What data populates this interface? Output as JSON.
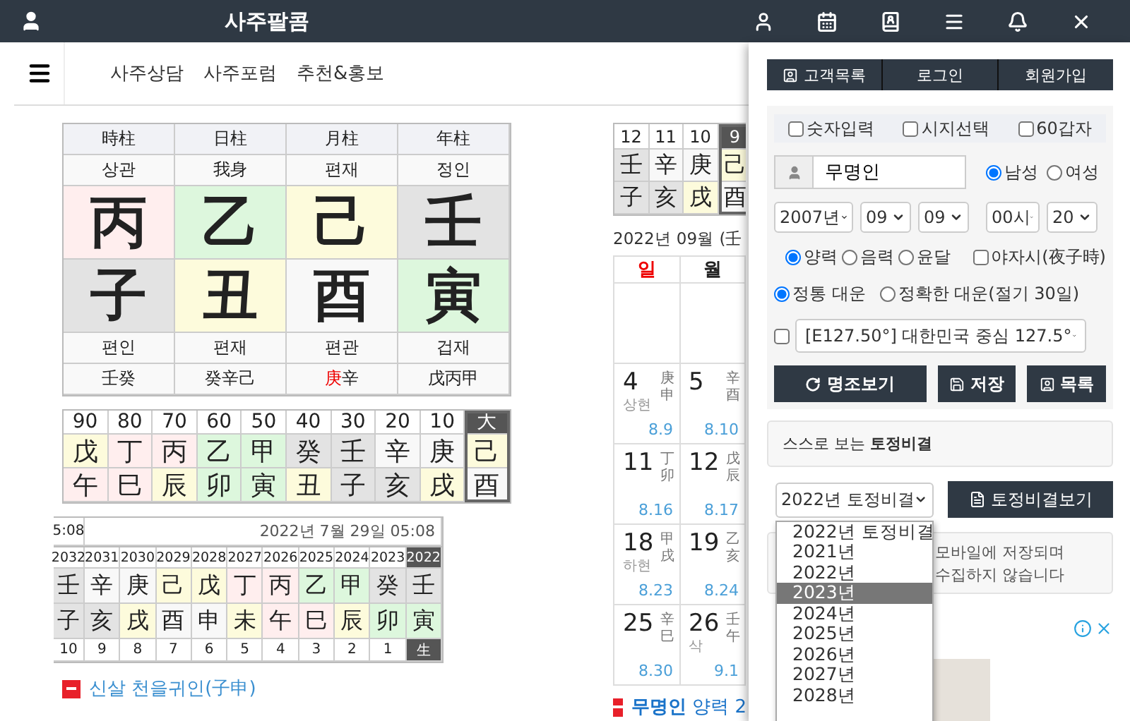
{
  "header": {
    "title": "사주팔콤"
  },
  "nav": {
    "links": [
      "사주상담",
      "사주포럼",
      "추천&홍보"
    ]
  },
  "pillars": {
    "columns": [
      "時柱",
      "日柱",
      "月柱",
      "年柱"
    ],
    "top_labels": [
      "상관",
      "我身",
      "편재",
      "정인"
    ],
    "stems": [
      {
        "char": "丙",
        "color": "#ffeeee"
      },
      {
        "char": "乙",
        "color": "#ddf7dd"
      },
      {
        "char": "己",
        "color": "#fdfbdc"
      },
      {
        "char": "壬",
        "color": "#e3e3e3"
      }
    ],
    "branches": [
      {
        "char": "子",
        "color": "#e3e3e3"
      },
      {
        "char": "丑",
        "color": "#fdfbdc"
      },
      {
        "char": "酉",
        "color": "#f8f8f8"
      },
      {
        "char": "寅",
        "color": "#ddf7dd"
      }
    ],
    "bottom_labels": [
      "편인",
      "편재",
      "편관",
      "겁재"
    ],
    "hidden_stems": [
      [
        {
          "text": "壬癸",
          "red": false
        }
      ],
      [
        {
          "text": "癸辛己",
          "red": false
        }
      ],
      [
        {
          "text": "庚",
          "red": true
        },
        {
          "text": "辛",
          "red": false
        }
      ],
      [
        {
          "text": "戊丙甲",
          "red": false
        }
      ]
    ]
  },
  "daewoon": {
    "columns": [
      {
        "age": "90",
        "stem": {
          "char": "戊",
          "color": "#fdfbdc"
        },
        "branch": {
          "char": "午",
          "color": "#ffeeee"
        },
        "selected": false
      },
      {
        "age": "80",
        "stem": {
          "char": "丁",
          "color": "#ffeeee"
        },
        "branch": {
          "char": "巳",
          "color": "#ffeeee"
        },
        "selected": false
      },
      {
        "age": "70",
        "stem": {
          "char": "丙",
          "color": "#ffeeee"
        },
        "branch": {
          "char": "辰",
          "color": "#fdfbdc"
        },
        "selected": false
      },
      {
        "age": "60",
        "stem": {
          "char": "乙",
          "color": "#ddf7dd"
        },
        "branch": {
          "char": "卯",
          "color": "#ddf7dd"
        },
        "selected": false
      },
      {
        "age": "50",
        "stem": {
          "char": "甲",
          "color": "#ddf7dd"
        },
        "branch": {
          "char": "寅",
          "color": "#ddf7dd"
        },
        "selected": false
      },
      {
        "age": "40",
        "stem": {
          "char": "癸",
          "color": "#e3e3e3"
        },
        "branch": {
          "char": "丑",
          "color": "#fdfbdc"
        },
        "selected": false
      },
      {
        "age": "30",
        "stem": {
          "char": "壬",
          "color": "#e3e3e3"
        },
        "branch": {
          "char": "子",
          "color": "#e3e3e3"
        },
        "selected": false
      },
      {
        "age": "20",
        "stem": {
          "char": "辛",
          "color": "#f8f8f8"
        },
        "branch": {
          "char": "亥",
          "color": "#e3e3e3"
        },
        "selected": false
      },
      {
        "age": "10",
        "stem": {
          "char": "庚",
          "color": "#f8f8f8"
        },
        "branch": {
          "char": "戌",
          "color": "#fdfbdc"
        },
        "selected": false
      },
      {
        "age": "大",
        "stem": {
          "char": "己",
          "color": "#fdfbdc"
        },
        "branch": {
          "char": "酉",
          "color": "#f8f8f8"
        },
        "selected": true
      }
    ]
  },
  "years": {
    "cut_time": "5:08",
    "date": "2022년 7월 29일 05:08",
    "columns": [
      {
        "year": "2032",
        "stem": {
          "char": "壬",
          "color": "#e3e3e3"
        },
        "branch": {
          "char": "子",
          "color": "#e3e3e3"
        },
        "age": "10",
        "selected": false
      },
      {
        "year": "2031",
        "stem": {
          "char": "辛",
          "color": "#f8f8f8"
        },
        "branch": {
          "char": "亥",
          "color": "#e3e3e3"
        },
        "age": "9",
        "selected": false
      },
      {
        "year": "2030",
        "stem": {
          "char": "庚",
          "color": "#f8f8f8"
        },
        "branch": {
          "char": "戌",
          "color": "#fdfbdc"
        },
        "age": "8",
        "selected": false
      },
      {
        "year": "2029",
        "stem": {
          "char": "己",
          "color": "#fdfbdc"
        },
        "branch": {
          "char": "酉",
          "color": "#f8f8f8"
        },
        "age": "7",
        "selected": false
      },
      {
        "year": "2028",
        "stem": {
          "char": "戊",
          "color": "#fdfbdc"
        },
        "branch": {
          "char": "申",
          "color": "#f8f8f8"
        },
        "age": "6",
        "selected": false
      },
      {
        "year": "2027",
        "stem": {
          "char": "丁",
          "color": "#ffeeee"
        },
        "branch": {
          "char": "未",
          "color": "#fdfbdc"
        },
        "age": "5",
        "selected": false
      },
      {
        "year": "2026",
        "stem": {
          "char": "丙",
          "color": "#ffeeee"
        },
        "branch": {
          "char": "午",
          "color": "#ffeeee"
        },
        "age": "4",
        "selected": false
      },
      {
        "year": "2025",
        "stem": {
          "char": "乙",
          "color": "#ddf7dd"
        },
        "branch": {
          "char": "巳",
          "color": "#ffeeee"
        },
        "age": "3",
        "selected": false
      },
      {
        "year": "2024",
        "stem": {
          "char": "甲",
          "color": "#ddf7dd"
        },
        "branch": {
          "char": "辰",
          "color": "#fdfbdc"
        },
        "age": "2",
        "selected": false
      },
      {
        "year": "2023",
        "stem": {
          "char": "癸",
          "color": "#e3e3e3"
        },
        "branch": {
          "char": "卯",
          "color": "#ddf7dd"
        },
        "age": "1",
        "selected": false
      },
      {
        "year": "2022",
        "stem": {
          "char": "壬",
          "color": "#e3e3e3"
        },
        "branch": {
          "char": "寅",
          "color": "#ddf7dd"
        },
        "age": "生",
        "selected": true
      }
    ]
  },
  "shinsal": {
    "text": "신살 천을귀인(子申)"
  },
  "months": {
    "columns": [
      {
        "num": "12",
        "stem": {
          "char": "壬",
          "color": "#e3e3e3"
        },
        "branch": {
          "char": "子",
          "color": "#e3e3e3"
        },
        "selected": false
      },
      {
        "num": "11",
        "stem": {
          "char": "辛",
          "color": "#f8f8f8"
        },
        "branch": {
          "char": "亥",
          "color": "#e3e3e3"
        },
        "selected": false
      },
      {
        "num": "10",
        "stem": {
          "char": "庚",
          "color": "#f8f8f8"
        },
        "branch": {
          "char": "戌",
          "color": "#fdfbdc"
        },
        "selected": false
      },
      {
        "num": "9",
        "stem": {
          "char": "己",
          "color": "#fdfbdc"
        },
        "branch": {
          "char": "酉",
          "color": "#f8f8f8"
        },
        "selected": true
      }
    ]
  },
  "calendar": {
    "title": "2022년 09월 (壬",
    "weekdays": [
      {
        "label": "일",
        "kind": "sunday"
      },
      {
        "label": "월",
        "kind": "weekday"
      }
    ],
    "weeks": [
      [
        {
          "kind": "empty"
        },
        {
          "kind": "empty"
        }
      ],
      [
        {
          "kind": "day",
          "day": "4",
          "phase": "상현",
          "ganji": "庚申",
          "lunar": "8.9"
        },
        {
          "kind": "day",
          "day": "5",
          "ganji": "辛酉",
          "lunar": "8.10"
        }
      ],
      [
        {
          "kind": "day",
          "day": "11",
          "ganji": "丁卯",
          "lunar": "8.16"
        },
        {
          "kind": "day",
          "day": "12",
          "ganji": "戊辰",
          "lunar": "8.17"
        }
      ],
      [
        {
          "kind": "day",
          "day": "18",
          "phase": "하현",
          "ganji": "甲戌",
          "lunar": "8.23"
        },
        {
          "kind": "day",
          "day": "19",
          "ganji": "乙亥",
          "lunar": "8.24"
        }
      ],
      [
        {
          "kind": "day",
          "day": "25",
          "ganji": "辛巳",
          "lunar": "8.30"
        },
        {
          "kind": "day",
          "day": "26",
          "phase": "삭",
          "ganji": "壬午",
          "lunar": "9.1"
        }
      ]
    ],
    "footer": "**무명인** 양력 2"
  },
  "panel": {
    "top_buttons": [
      "고객목록",
      "로그인",
      "회원가입"
    ],
    "options": [
      {
        "label": "숫자입력",
        "checked": false
      },
      {
        "label": "시지선택",
        "checked": false
      },
      {
        "label": "60갑자",
        "checked": false
      }
    ],
    "name": "무명인",
    "genders": [
      {
        "label": "남성",
        "selected": true
      },
      {
        "label": "여성",
        "selected": false
      }
    ],
    "date_selects": [
      "2007년",
      "09",
      "09",
      "00시",
      "20"
    ],
    "calendar_types": [
      {
        "label": "양력",
        "selected": true
      },
      {
        "label": "음력",
        "selected": false
      },
      {
        "label": "윤달",
        "selected": false
      }
    ],
    "night_hour": {
      "label": "야자시(夜子時)",
      "checked": false
    },
    "daewoon_types": [
      {
        "label": "정통 대운",
        "selected": true
      },
      {
        "label": "정확한 대운(절기 30일)",
        "selected": false
      }
    ],
    "location": {
      "checked": false,
      "value": "[E127.50°] 대한민국 중심 127.5°"
    },
    "actions": [
      "명조보기",
      "저장",
      "목록"
    ],
    "tojeong_title": "스스로 보는 **토정비결**",
    "tojeong_select": "2022년 토정비결",
    "tojeong_button": "토정비결보기",
    "notice_lines": [
      "모바일에 저장되며",
      "수집하지 않습니다"
    ],
    "dropdown": [
      {
        "label": "2022년 토정비결",
        "selected": false
      },
      {
        "label": "2021년",
        "selected": false
      },
      {
        "label": "2022년",
        "selected": false
      },
      {
        "label": "2023년",
        "selected": true
      },
      {
        "label": "2024년",
        "selected": false
      },
      {
        "label": "2025년",
        "selected": false
      },
      {
        "label": "2026년",
        "selected": false
      },
      {
        "label": "2027년",
        "selected": false
      },
      {
        "label": "2028년",
        "selected": false
      }
    ]
  }
}
